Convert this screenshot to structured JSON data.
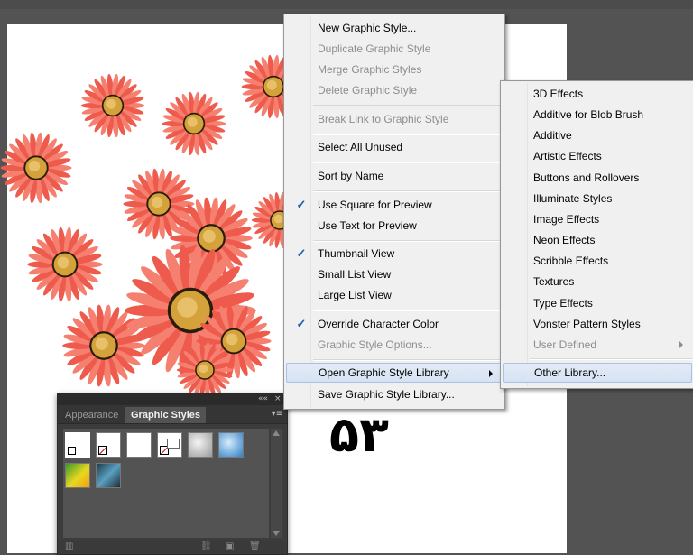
{
  "canvas": {
    "artwork_text": "۵۳"
  },
  "panel": {
    "tabs": [
      {
        "label": "Appearance"
      },
      {
        "label": "Graphic Styles"
      }
    ],
    "collapse_label": "««",
    "close_label": "×",
    "menu_label": "▾≡"
  },
  "menu": {
    "items": [
      {
        "label": "New Graphic Style...",
        "disabled": false
      },
      {
        "label": "Duplicate Graphic Style",
        "disabled": true
      },
      {
        "label": "Merge Graphic Styles",
        "disabled": true
      },
      {
        "label": "Delete Graphic Style",
        "disabled": true
      },
      {
        "label": "Break Link to Graphic Style",
        "disabled": true
      },
      {
        "label": "Select All Unused",
        "disabled": false
      },
      {
        "label": "Sort by Name",
        "disabled": false
      },
      {
        "label": "Use Square for Preview",
        "disabled": false,
        "checked": true
      },
      {
        "label": "Use Text for Preview",
        "disabled": false
      },
      {
        "label": "Thumbnail View",
        "disabled": false,
        "checked": true
      },
      {
        "label": "Small List View",
        "disabled": false
      },
      {
        "label": "Large List View",
        "disabled": false
      },
      {
        "label": "Override Character Color",
        "disabled": false,
        "checked": true
      },
      {
        "label": "Graphic Style Options...",
        "disabled": true
      },
      {
        "label": "Open Graphic Style Library",
        "disabled": false,
        "highlighted": true,
        "submenu": true
      },
      {
        "label": "Save Graphic Style Library...",
        "disabled": false
      }
    ],
    "check_glyph": "✓"
  },
  "submenu": {
    "items": [
      {
        "label": "3D Effects"
      },
      {
        "label": "Additive for Blob Brush"
      },
      {
        "label": "Additive"
      },
      {
        "label": "Artistic Effects"
      },
      {
        "label": "Buttons and Rollovers"
      },
      {
        "label": "Illuminate Styles"
      },
      {
        "label": "Image Effects"
      },
      {
        "label": "Neon Effects"
      },
      {
        "label": "Scribble Effects"
      },
      {
        "label": "Textures"
      },
      {
        "label": "Type Effects"
      },
      {
        "label": "Vonster Pattern Styles"
      },
      {
        "label": "User Defined",
        "disabled": true,
        "submenu": true
      },
      {
        "label": "Other Library...",
        "highlighted": true
      }
    ]
  },
  "colors": {
    "petal": "#ee5a4c",
    "petal_light": "#f58070",
    "center": "#d4a23a",
    "center_ring": "#2a1c0a"
  }
}
